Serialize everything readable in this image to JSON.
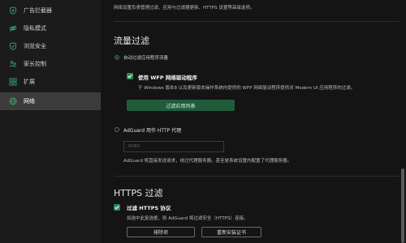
{
  "sidebar": {
    "items": [
      {
        "label": "广告拦截器",
        "icon": "shield-x-icon"
      },
      {
        "label": "隐私模式",
        "icon": "eye-off-icon"
      },
      {
        "label": "浏览安全",
        "icon": "shield-check-icon"
      },
      {
        "label": "家长控制",
        "icon": "family-icon"
      },
      {
        "label": "扩展",
        "icon": "grid-icon"
      },
      {
        "label": "网络",
        "icon": "globe-icon",
        "active": true
      }
    ]
  },
  "network": {
    "intro": "网络设置负责管理过滤、应用与过滤器更新、HTTPS 设置等高级选项。",
    "traffic": {
      "title": "流量过滤",
      "auto_radio_label": "自动过滤应用程序流量",
      "wfp_label": "使用 WFP 网络驱动程序",
      "wfp_desc": "于 Windows 版本8 以及更新版本操作系统内提供的 WFP 网络驱动程序提供对 Modern UI 应用程序的过滤。",
      "filter_apps_button": "过滤应用列表",
      "proxy_radio_label": "AdGuard 用作 HTTP 代理",
      "port_placeholder": "8080",
      "proxy_desc": "AdGuard 将直接发送请求，绕过代理服务器。甚至是系统设置内配置了代理服务器。"
    },
    "https": {
      "title": "HTTPS 过滤",
      "check_label": "过滤 HTTPS 协议",
      "check_desc": "如选中此复选框，则 AdGuard 将过滤安全（HTTPS）连接。",
      "exclusions_button": "排除项",
      "reinstall_button": "重新安装证书"
    }
  },
  "colors": {
    "accent": "#2e8b57",
    "sidebar_active": "#3b3b3b",
    "background": "#141414"
  }
}
